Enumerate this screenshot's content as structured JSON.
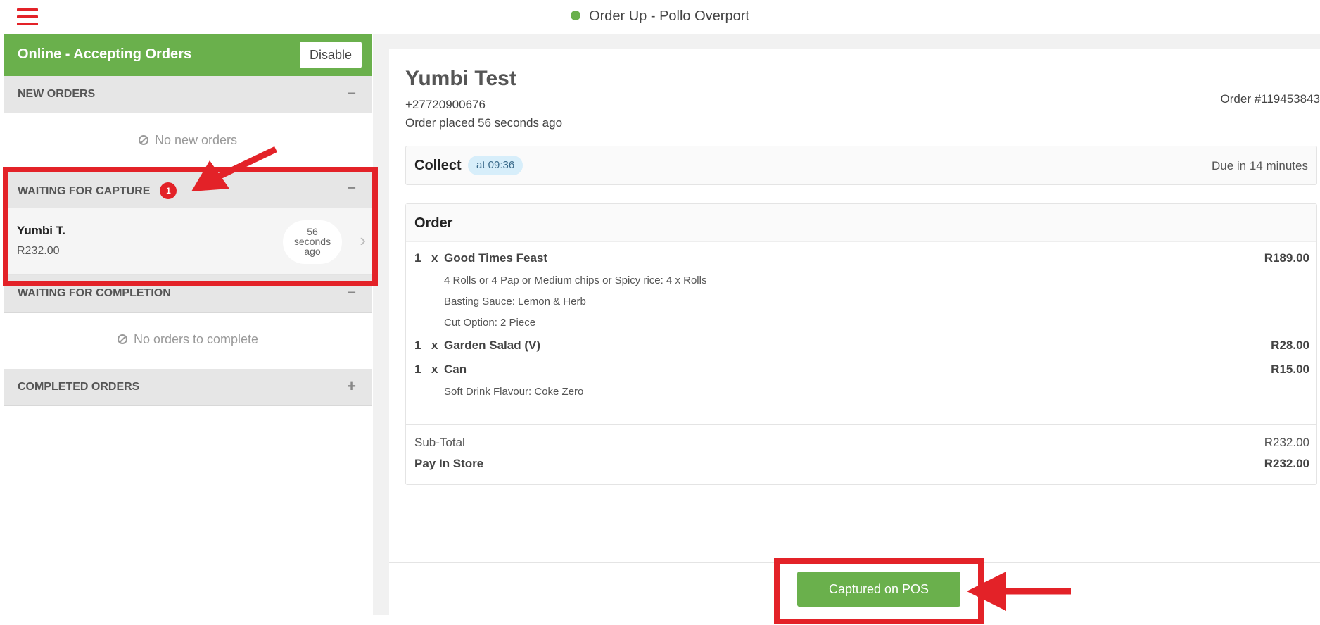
{
  "header": {
    "title": "Order Up - Pollo Overport"
  },
  "sidebar": {
    "online_status": "Online - Accepting Orders",
    "disable_label": "Disable",
    "new_orders": {
      "title": "NEW ORDERS",
      "toggle": "−",
      "empty": "No new orders"
    },
    "waiting_capture": {
      "title": "WAITING FOR CAPTURE",
      "toggle": "−",
      "count": "1",
      "order": {
        "name": "Yumbi T.",
        "amount": "R232.00",
        "time_line1": "56",
        "time_line2": "seconds",
        "time_line3": "ago"
      }
    },
    "waiting_completion": {
      "title": "WAITING FOR COMPLETION",
      "toggle": "−",
      "empty": "No orders to complete"
    },
    "completed": {
      "title": "COMPLETED ORDERS",
      "toggle": "+"
    }
  },
  "order": {
    "customer_name": "Yumbi Test",
    "phone": "+27720900676",
    "placed": "Order placed 56 seconds ago",
    "number": "Order #119453843",
    "collect_label": "Collect",
    "collect_time": "at 09:36",
    "due": "Due in 14 minutes",
    "section_label": "Order",
    "items": [
      {
        "qty": "1",
        "x": "x",
        "name": "Good Times Feast",
        "price": "R189.00",
        "modifiers": [
          "4 Rolls or 4 Pap or Medium chips or Spicy rice: 4 x Rolls",
          "Basting Sauce: Lemon & Herb",
          "Cut Option: 2 Piece"
        ]
      },
      {
        "qty": "1",
        "x": "x",
        "name": "Garden Salad (V)",
        "price": "R28.00",
        "modifiers": []
      },
      {
        "qty": "1",
        "x": "x",
        "name": "Can",
        "price": "R15.00",
        "modifiers": [
          "Soft Drink Flavour: Coke Zero"
        ]
      }
    ],
    "subtotal_label": "Sub-Total",
    "subtotal": "R232.00",
    "pay_label": "Pay In Store",
    "pay_value": "R232.00"
  },
  "actions": {
    "captured_label": "Captured on POS"
  },
  "colors": {
    "accent_green": "#6ab04c",
    "annotation_red": "#e32228",
    "badge_red": "#e32228"
  }
}
